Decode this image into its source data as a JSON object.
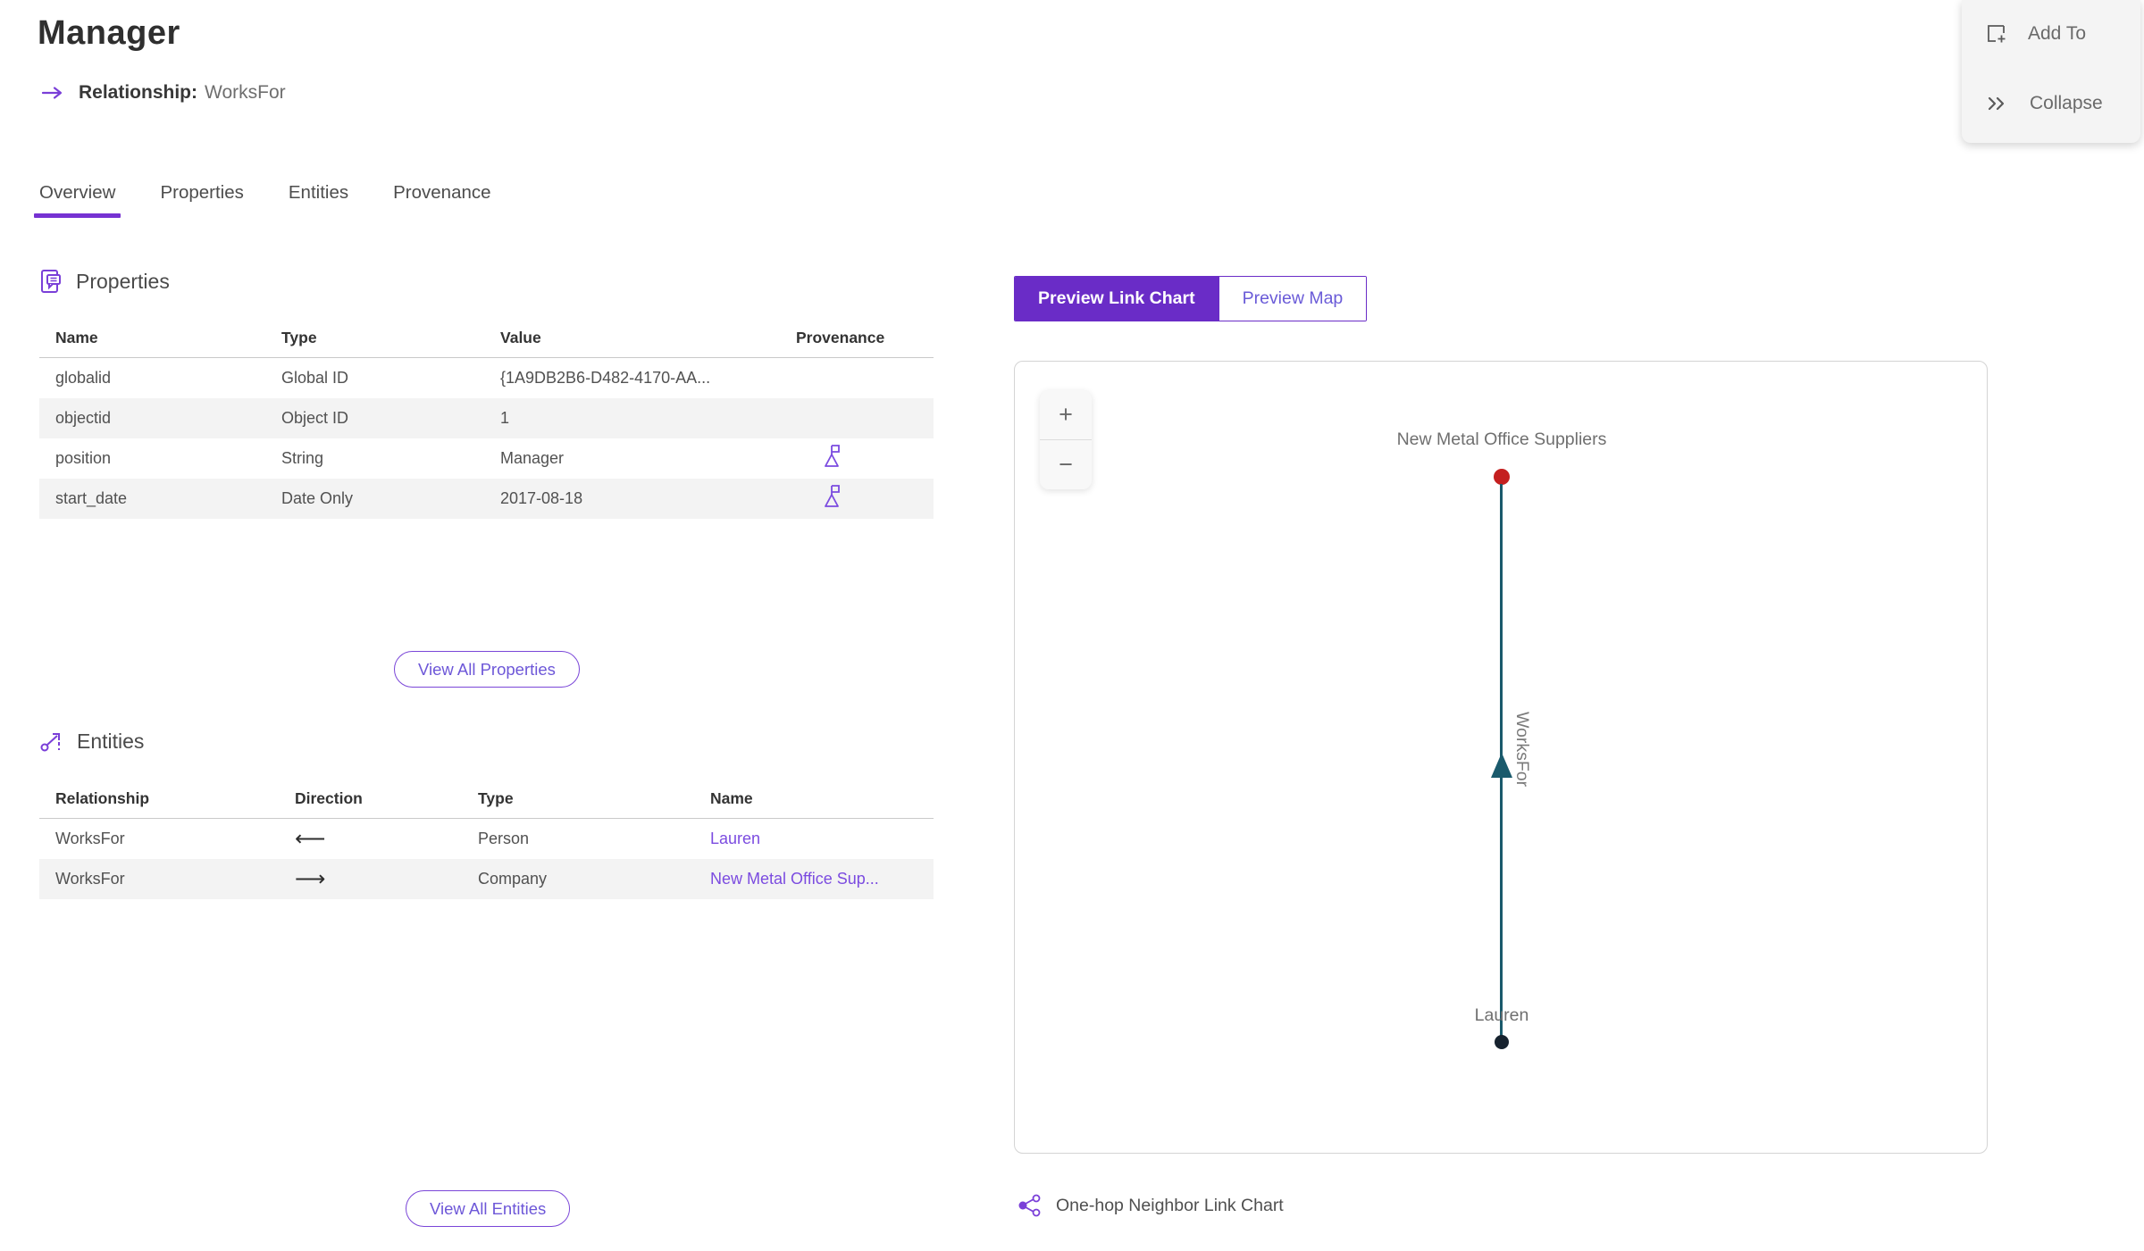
{
  "header": {
    "title": "Manager",
    "subtitle_label": "Relationship:",
    "subtitle_value": "WorksFor"
  },
  "actions": {
    "add_to_label": "Add To",
    "collapse_label": "Collapse"
  },
  "tabs": [
    {
      "label": "Overview",
      "active": true
    },
    {
      "label": "Properties",
      "active": false
    },
    {
      "label": "Entities",
      "active": false
    },
    {
      "label": "Provenance",
      "active": false
    }
  ],
  "properties_section": {
    "title": "Properties",
    "columns": {
      "name": "Name",
      "type": "Type",
      "value": "Value",
      "provenance": "Provenance"
    },
    "rows": [
      {
        "name": "globalid",
        "type": "Global ID",
        "value": "{1A9DB2B6-D482-4170-AA...",
        "has_provenance": false
      },
      {
        "name": "objectid",
        "type": "Object ID",
        "value": "1",
        "has_provenance": false
      },
      {
        "name": "position",
        "type": "String",
        "value": "Manager",
        "has_provenance": true
      },
      {
        "name": "start_date",
        "type": "Date Only",
        "value": "2017-08-18",
        "has_provenance": true
      }
    ],
    "view_all_label": "View All Properties"
  },
  "entities_section": {
    "title": "Entities",
    "columns": {
      "relationship": "Relationship",
      "direction": "Direction",
      "type": "Type",
      "name": "Name"
    },
    "rows": [
      {
        "relationship": "WorksFor",
        "direction": "⟵",
        "type": "Person",
        "name": "Lauren"
      },
      {
        "relationship": "WorksFor",
        "direction": "⟶",
        "type": "Company",
        "name": "New Metal Office Sup..."
      }
    ],
    "view_all_label": "View All Entities"
  },
  "preview": {
    "toggle_link_chart": "Preview Link Chart",
    "toggle_map": "Preview Map",
    "zoom_in": "+",
    "zoom_out": "−",
    "caption": "One-hop Neighbor Link Chart"
  },
  "chart_data": {
    "type": "link-chart",
    "nodes": [
      {
        "label": "New Metal Office Suppliers",
        "entity_type": "Company",
        "color": "#c41f1f",
        "position": "top"
      },
      {
        "label": "Lauren",
        "entity_type": "Person",
        "color": "#16222e",
        "position": "bottom"
      }
    ],
    "edges": [
      {
        "label": "WorksFor",
        "from": "Lauren",
        "to": "New Metal Office Suppliers",
        "color": "#1a5a6c",
        "direction": "up"
      }
    ],
    "legend_position": "none",
    "grid": false
  },
  "colors": {
    "accent_purple": "#6a2cc7",
    "link_purple": "#7b4be0",
    "tab_underline": "#7632d2",
    "edge_teal": "#1a5a6c",
    "node_red": "#c41f1f",
    "node_dark": "#16222e",
    "row_stripe": "#f3f3f3"
  }
}
